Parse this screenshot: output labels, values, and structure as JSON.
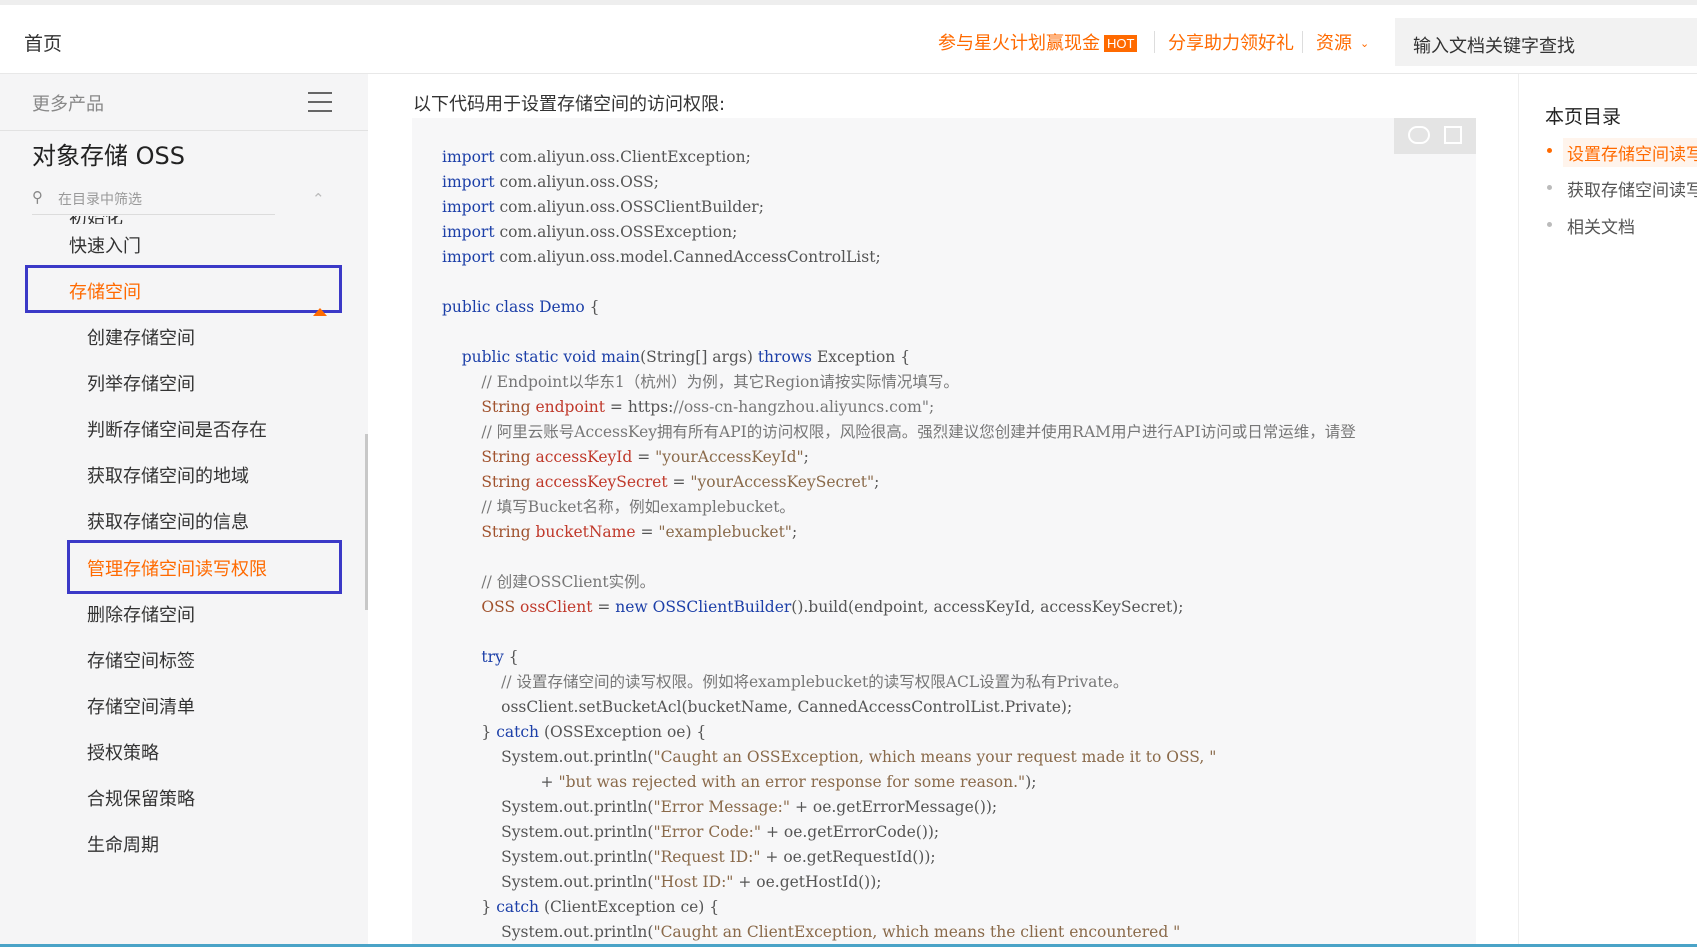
{
  "header": {
    "home": "首页",
    "promo": "参与星火计划赢现金",
    "hot_badge": "HOT",
    "share": "分享助力领好礼",
    "resources": "资源",
    "search_placeholder": "输入文档关键字查找"
  },
  "sidebar": {
    "more_products": "更多产品",
    "product_title": "对象存储 OSS",
    "filter_placeholder": "在目录中筛选",
    "cut_item": "初始化",
    "items": [
      {
        "label": "快速入门",
        "level": 1
      },
      {
        "label": "存储空间",
        "level": 1,
        "active": true,
        "expanded": true
      },
      {
        "label": "创建存储空间",
        "level": 2
      },
      {
        "label": "列举存储空间",
        "level": 2
      },
      {
        "label": "判断存储空间是否存在",
        "level": 2
      },
      {
        "label": "获取存储空间的地域",
        "level": 2
      },
      {
        "label": "获取存储空间的信息",
        "level": 2
      },
      {
        "label": "管理存储空间读写权限",
        "level": 2,
        "active": true
      },
      {
        "label": "删除存储空间",
        "level": 2
      },
      {
        "label": "存储空间标签",
        "level": 2
      },
      {
        "label": "存储空间清单",
        "level": 2
      },
      {
        "label": "授权策略",
        "level": 2
      },
      {
        "label": "合规保留策略",
        "level": 2
      },
      {
        "label": "生命周期",
        "level": 2
      }
    ]
  },
  "content": {
    "intro": "以下代码用于设置存储空间的访问权限:",
    "code_lines": [
      "import com.aliyun.oss.ClientException;",
      "import com.aliyun.oss.OSS;",
      "import com.aliyun.oss.OSSClientBuilder;",
      "import com.aliyun.oss.OSSException;",
      "import com.aliyun.oss.model.CannedAccessControlList;",
      "",
      "public class Demo {",
      "",
      "    public static void main(String[] args) throws Exception {",
      "        // Endpoint以华东1（杭州）为例，其它Region请按实际情况填写。",
      "        String endpoint = \"https://oss-cn-hangzhou.aliyuncs.com\";",
      "        // 阿里云账号AccessKey拥有所有API的访问权限，风险很高。强烈建议您创建并使用RAM用户进行API访问或日常运维，请登",
      "        String accessKeyId = \"yourAccessKeyId\";",
      "        String accessKeySecret = \"yourAccessKeySecret\";",
      "        // 填写Bucket名称，例如examplebucket。",
      "        String bucketName = \"examplebucket\";",
      "",
      "        // 创建OSSClient实例。",
      "        OSS ossClient = new OSSClientBuilder().build(endpoint, accessKeyId, accessKeySecret);",
      "",
      "        try {",
      "            // 设置存储空间的读写权限。例如将examplebucket的读写权限ACL设置为私有Private。",
      "            ossClient.setBucketAcl(bucketName, CannedAccessControlList.Private);",
      "        } catch (OSSException oe) {",
      "            System.out.println(\"Caught an OSSException, which means your request made it to OSS, \"",
      "                    + \"but was rejected with an error response for some reason.\");",
      "            System.out.println(\"Error Message:\" + oe.getErrorMessage());",
      "            System.out.println(\"Error Code:\" + oe.getErrorCode());",
      "            System.out.println(\"Request ID:\" + oe.getRequestId());",
      "            System.out.println(\"Host ID:\" + oe.getHostId());",
      "        } catch (ClientException ce) {",
      "            System.out.println(\"Caught an ClientException, which means the client encountered \""
    ]
  },
  "toc": {
    "title": "本页目录",
    "items": [
      {
        "label": "设置存储空间读写",
        "active": true
      },
      {
        "label": "获取存储空间读写"
      },
      {
        "label": "相关文档"
      }
    ]
  },
  "colors": {
    "accent": "#ff6a00",
    "highlight_border": "#3b39c7",
    "keyword": "#1c3fa8",
    "sidebar_bg": "#f5f5f6"
  }
}
